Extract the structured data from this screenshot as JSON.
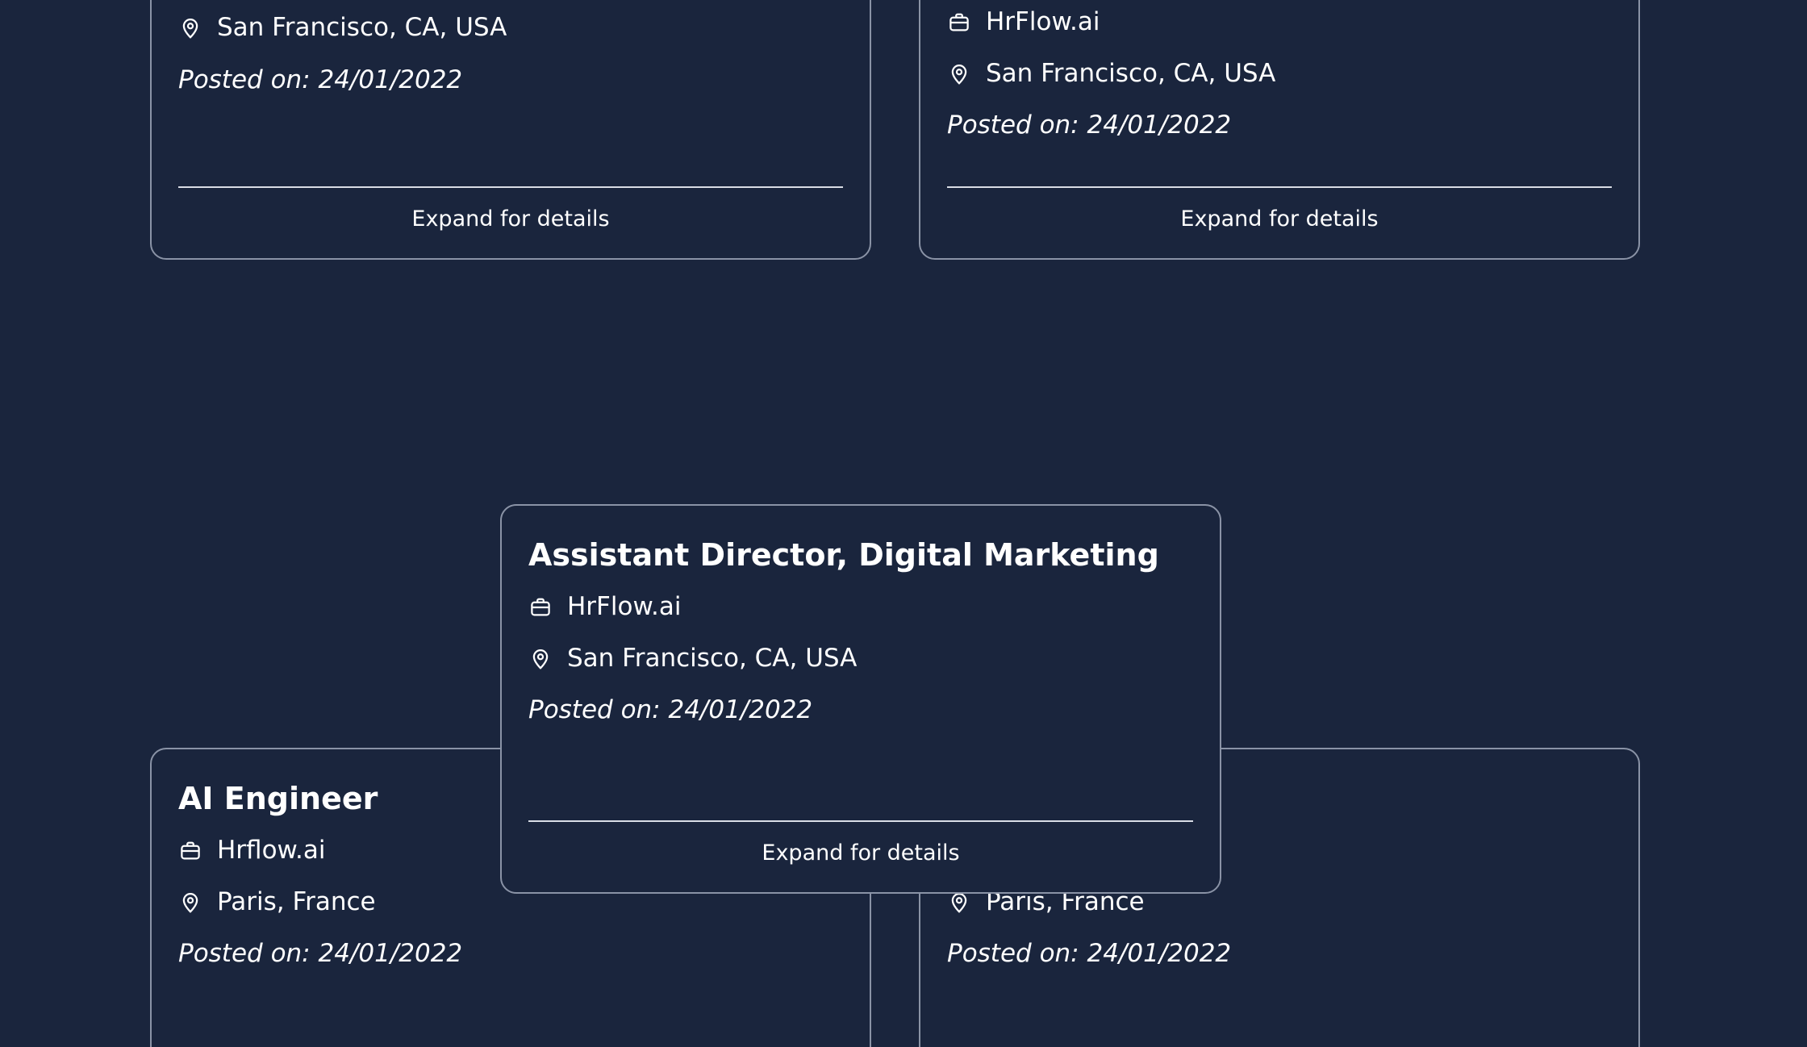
{
  "cards": [
    {
      "company": "",
      "location": "San Francisco, CA, USA",
      "posted": "Posted on: 24/01/2022",
      "expand": "Expand for details"
    },
    {
      "company": "HrFlow.ai",
      "location": "San Francisco, CA, USA",
      "posted": "Posted on: 24/01/2022",
      "expand": "Expand for details"
    },
    {
      "title": "AI Engineer",
      "company": "Hrflow.ai",
      "location": "Paris, France",
      "posted": "Posted on: 24/01/2022"
    },
    {
      "location": "Paris, France",
      "posted": "Posted on: 24/01/2022"
    },
    {
      "title": "Assistant Director, Digital Marketing",
      "company": "HrFlow.ai",
      "location": "San Francisco, CA, USA",
      "posted": "Posted on: 24/01/2022",
      "expand": "Expand for details"
    }
  ],
  "icons": {
    "company": "briefcase-icon",
    "location": "map-pin-icon"
  },
  "colors": {
    "background": "#1a253d",
    "card_border": "#8a93a6",
    "text": "#ffffff"
  }
}
